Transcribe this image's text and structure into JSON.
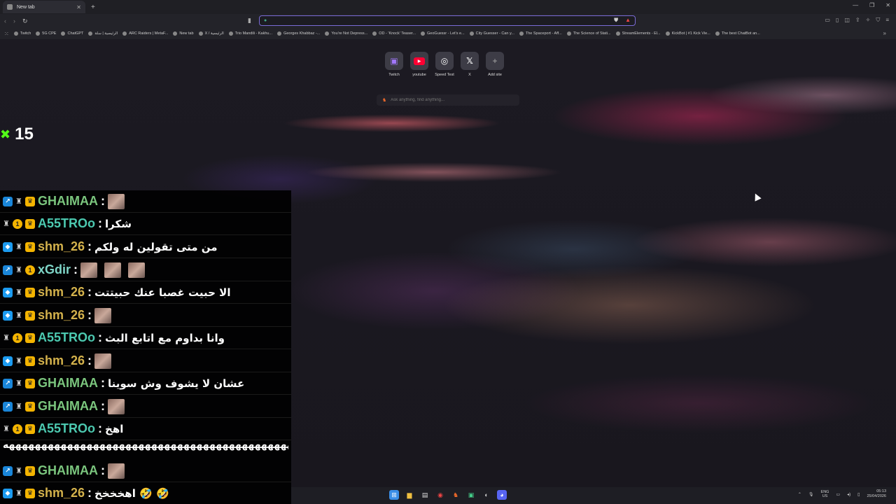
{
  "browser": {
    "tab": {
      "title": "New tab"
    },
    "omnibox": {
      "value": ""
    },
    "bookmarks": [
      "Twitch",
      "5G CPE",
      "ChatGPT",
      "الرئيسية | سلة",
      "ARC Raiders | MetaF...",
      "New tab",
      "X / الرئيسية",
      "Trio Mandili - Kakhu...",
      "Georges Khabbaz -...",
      "You're Not Depress...",
      "OD - 'Knock' Teaser...",
      "GeoGuessr - Let's e...",
      "City Guesser - Can y...",
      "The Spaceport - Aff...",
      "The Science of Stati...",
      "StreamElements - El...",
      "KickBot | #1 Kick Vie...",
      "The best ChatBot an..."
    ]
  },
  "shortcuts": [
    {
      "label": "Twitch",
      "icon": "twitch-icon"
    },
    {
      "label": "youtube",
      "icon": "youtube-icon"
    },
    {
      "label": "Speed Test",
      "icon": "speedtest-icon"
    },
    {
      "label": "X",
      "icon": "x-icon"
    },
    {
      "label": "Add site",
      "icon": "plus-icon"
    }
  ],
  "ask": {
    "placeholder": "Ask anything, find anything..."
  },
  "counter": {
    "value": "15",
    "icon": "kick-icon"
  },
  "chat": {
    "messages": [
      {
        "user": "GHAIMAA",
        "color": "#7bc67e",
        "text": "",
        "emotes": 1
      },
      {
        "user": "A55TROo",
        "color": "#4cc9b0",
        "text": "شكرا",
        "emotes": 0
      },
      {
        "user": "shm_26",
        "color": "#d4b24c",
        "text": "من متى تقولين له ولكم",
        "emotes": 0
      },
      {
        "user": "xGdir",
        "color": "#7fd6c8",
        "text": "",
        "emotes": 3
      },
      {
        "user": "shm_26",
        "color": "#d4b24c",
        "text": "الا حبيت غصبا عنك حبيتتت",
        "emotes": 0
      },
      {
        "user": "shm_26",
        "color": "#d4b24c",
        "text": "",
        "emotes": 1
      },
      {
        "user": "A55TROo",
        "color": "#4cc9b0",
        "text": "وانا بداوم مع اتابع البث",
        "emotes": 0
      },
      {
        "user": "shm_26",
        "color": "#d4b24c",
        "text": "",
        "emotes": 1
      },
      {
        "user": "GHAIMAA",
        "color": "#7bc67e",
        "text": "عشان لا يشوف وش سوينا",
        "emotes": 0
      },
      {
        "user": "GHAIMAA",
        "color": "#7bc67e",
        "text": "",
        "emotes": 1
      },
      {
        "user": "A55TROo",
        "color": "#4cc9b0",
        "text": "اهخ",
        "emotes": 0
      },
      {
        "user": "GHAIMAA",
        "color": "#7bc67e",
        "text": "",
        "emotes": 1
      },
      {
        "user": "shm_26",
        "color": "#d4b24c",
        "text": "اهخخخخ 🤣 🤣",
        "emotes": 0
      }
    ],
    "spam_line": "ههههههههههههههههههههههههههههههههههههههههههههههههههه"
  },
  "tray": {
    "lang_top": "ENG",
    "lang_bottom": "US",
    "time": "05:13",
    "date": "25/04/2026"
  }
}
